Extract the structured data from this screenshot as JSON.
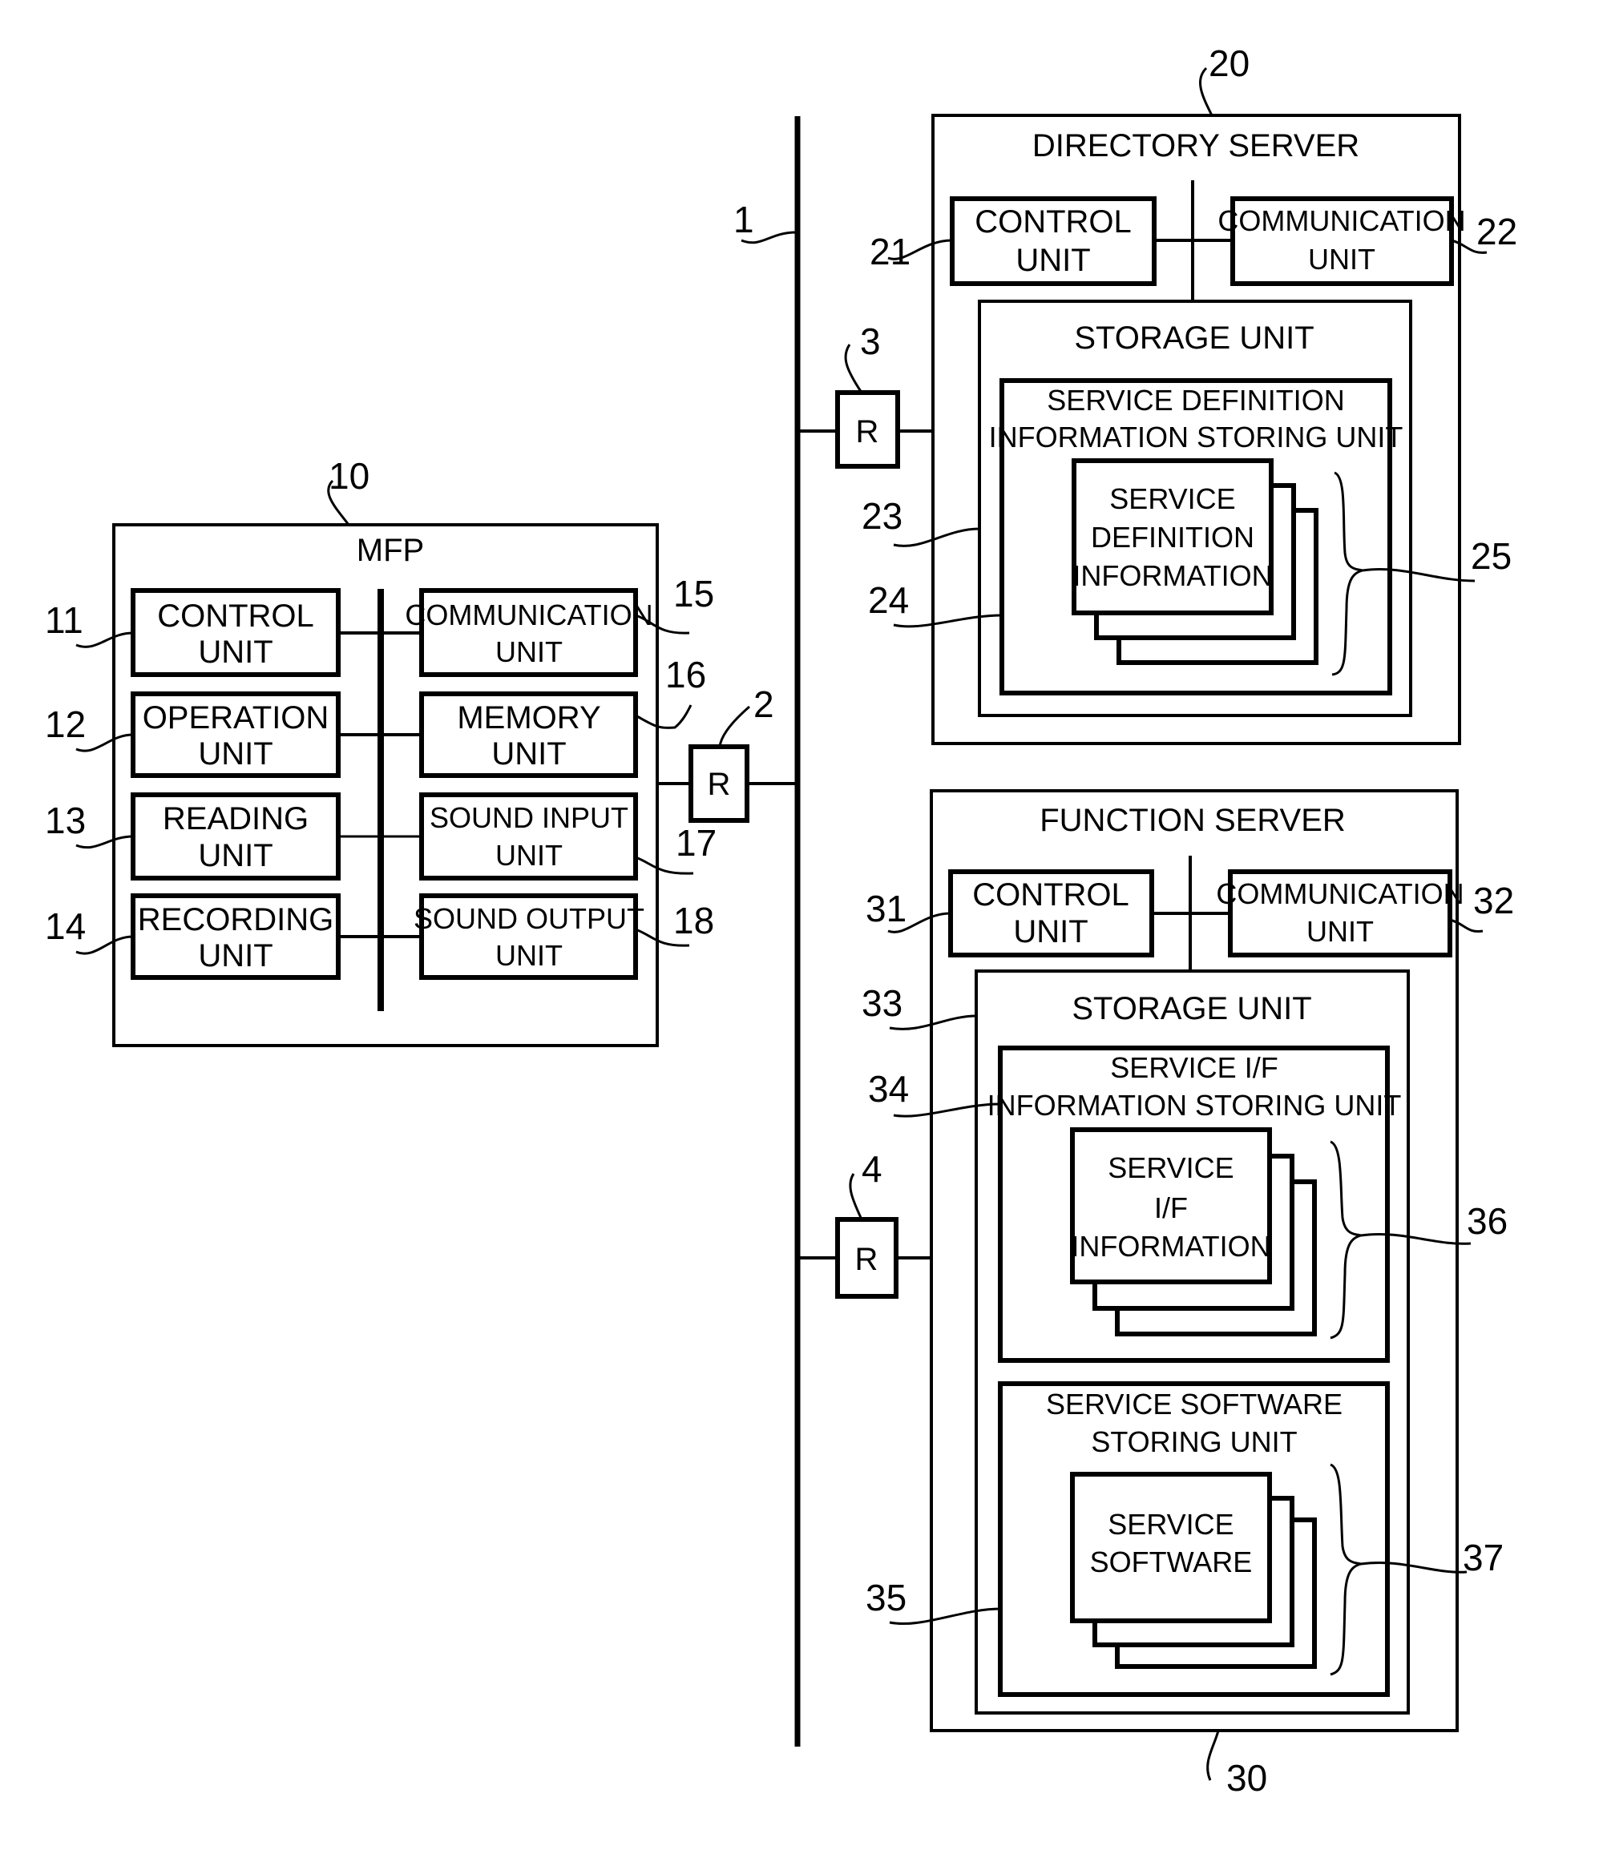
{
  "network": {
    "ref": "1"
  },
  "routers": [
    {
      "ref": "2",
      "label": "R"
    },
    {
      "ref": "3",
      "label": "R"
    },
    {
      "ref": "4",
      "label": "R"
    }
  ],
  "mfp": {
    "ref": "10",
    "title": "MFP",
    "units": [
      {
        "ref": "11",
        "line1": "CONTROL",
        "line2": "UNIT"
      },
      {
        "ref": "12",
        "line1": "OPERATION",
        "line2": "UNIT"
      },
      {
        "ref": "13",
        "line1": "READING",
        "line2": "UNIT"
      },
      {
        "ref": "14",
        "line1": "RECORDING",
        "line2": "UNIT"
      },
      {
        "ref": "15",
        "line1": "COMMUNICATION",
        "line2": "UNIT"
      },
      {
        "ref": "16",
        "line1": "MEMORY",
        "line2": "UNIT"
      },
      {
        "ref": "17",
        "line1": "SOUND INPUT",
        "line2": "UNIT"
      },
      {
        "ref": "18",
        "line1": "SOUND OUTPUT",
        "line2": "UNIT"
      }
    ]
  },
  "directory_server": {
    "ref": "20",
    "title": "DIRECTORY SERVER",
    "control": {
      "ref": "21",
      "line1": "CONTROL",
      "line2": "UNIT"
    },
    "communication": {
      "ref": "22",
      "line1": "COMMUNICATION",
      "line2": "UNIT"
    },
    "storage": {
      "ref": "23",
      "title": "STORAGE UNIT"
    },
    "storing_unit": {
      "ref": "24",
      "line1": "SERVICE DEFINITION",
      "line2": "INFORMATION STORING UNIT"
    },
    "info": {
      "ref": "25",
      "line1": "SERVICE",
      "line2": "DEFINITION",
      "line3": "INFORMATION"
    }
  },
  "function_server": {
    "ref": "30",
    "title": "FUNCTION SERVER",
    "control": {
      "ref": "31",
      "line1": "CONTROL",
      "line2": "UNIT"
    },
    "communication": {
      "ref": "32",
      "line1": "COMMUNICATION",
      "line2": "UNIT"
    },
    "storage": {
      "ref": "33",
      "title": "STORAGE UNIT"
    },
    "if_storing_unit": {
      "ref": "34",
      "line1": "SERVICE I/F",
      "line2": "INFORMATION STORING UNIT"
    },
    "sw_storing_unit": {
      "ref": "35",
      "line1": "SERVICE SOFTWARE",
      "line2": "STORING UNIT"
    },
    "if_info": {
      "ref": "36",
      "line1": "SERVICE",
      "line2": "I/F",
      "line3": "INFORMATION"
    },
    "software": {
      "ref": "37",
      "line1": "SERVICE",
      "line2": "SOFTWARE"
    }
  }
}
